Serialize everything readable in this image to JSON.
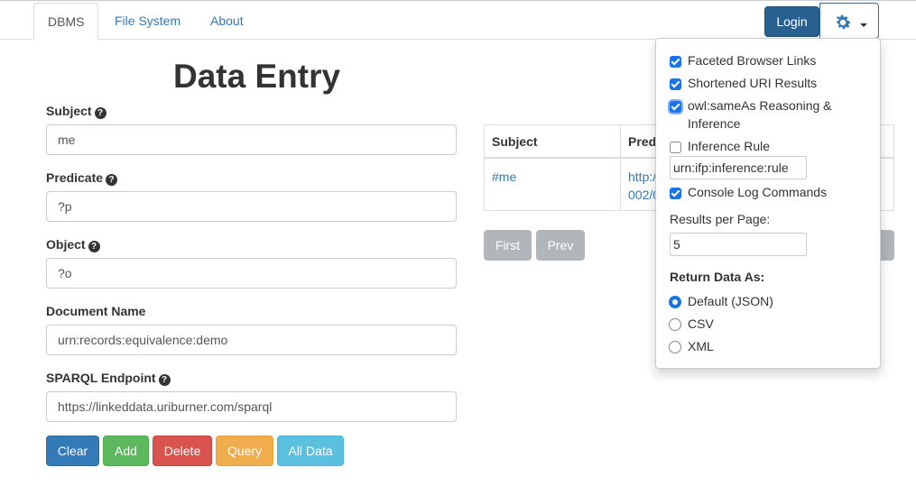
{
  "nav": {
    "tabs": [
      "DBMS",
      "File System",
      "About"
    ],
    "login_label": "Login",
    "settings_icon": "gear-icon"
  },
  "page": {
    "title": "Data Entry"
  },
  "form": {
    "subject_label": "Subject",
    "subject_value": "me",
    "predicate_label": "Predicate",
    "predicate_value": "?p",
    "object_label": "Object",
    "object_value": "?o",
    "document_label": "Document Name",
    "document_value": "urn:records:equivalence:demo",
    "endpoint_label": "SPARQL Endpoint",
    "endpoint_value": "https://linkeddata.uriburner.com/sparql"
  },
  "actions": {
    "clear": "Clear",
    "add": "Add",
    "delete": "Delete",
    "query": "Query",
    "all_data": "All Data"
  },
  "results": {
    "headers": [
      "Subject",
      "Pred"
    ],
    "row": {
      "subject": "#me",
      "predicate_line1": "http:/",
      "predicate_line2": "002/0"
    },
    "first": "First",
    "prev": "Prev"
  },
  "settings": {
    "faceted": "Faceted Browser Links",
    "shortened": "Shortened URI Results",
    "sameas_line1": "owl:sameAs Reasoning &",
    "sameas_line2": "Inference",
    "inference_rule": "Inference Rule",
    "inference_rule_value": "urn:ifp:inference:rule",
    "console_log": "Console Log Commands",
    "results_per_page_label": "Results per Page:",
    "results_per_page_value": "5",
    "return_label": "Return Data As:",
    "formats": [
      "Default (JSON)",
      "CSV",
      "XML"
    ],
    "selected_format": "Default (JSON)"
  },
  "colors": {
    "primary": "#337ab7",
    "success": "#5cb85c",
    "danger": "#d9534f",
    "warning": "#f0ad4e",
    "info": "#5bc0de",
    "checkbox": "#1a73e8"
  }
}
